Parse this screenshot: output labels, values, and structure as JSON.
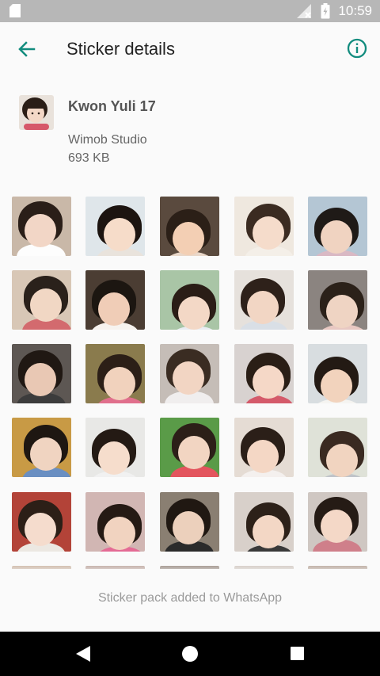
{
  "status_bar": {
    "time": "10:59",
    "icons": [
      "sd-card-icon",
      "signal-icon",
      "battery-icon"
    ]
  },
  "app_bar": {
    "title": "Sticker details",
    "back_icon": "arrow-left-icon",
    "info_icon": "info-icon",
    "accent_color": "#128c7e"
  },
  "pack": {
    "name": "Kwon Yuli 17",
    "publisher": "Wimob Studio",
    "size": "693 KB"
  },
  "stickers": [
    {
      "bg": "#c9b8a8",
      "hair": "#2a1e18",
      "skin": "#f2d6c6",
      "cloth": "#fdfdfd"
    },
    {
      "bg": "#dfe6ea",
      "hair": "#1c1410",
      "skin": "#f6dcc9",
      "cloth": "#e9e3dc"
    },
    {
      "bg": "#5a4a3e",
      "hair": "#2b1f17",
      "skin": "#f3cfb4",
      "cloth": "#e9d7c9"
    },
    {
      "bg": "#efe8df",
      "hair": "#3b2b21",
      "skin": "#f5dccb",
      "cloth": "#f4efe8"
    },
    {
      "bg": "#b4c6d4",
      "hair": "#1f1a17",
      "skin": "#f0d3c1",
      "cloth": "#d9b9c4"
    },
    {
      "bg": "#d8c7b6",
      "hair": "#2a211b",
      "skin": "#f1d7c4",
      "cloth": "#d36a6e"
    },
    {
      "bg": "#4b3d33",
      "hair": "#1c1611",
      "skin": "#f0cdb7",
      "cloth": "#f7f3ef"
    },
    {
      "bg": "#a9c5a6",
      "hair": "#2a1d16",
      "skin": "#f3d8c6",
      "cloth": "#e9edf2"
    },
    {
      "bg": "#e6e1dc",
      "hair": "#2e211a",
      "skin": "#f2d6c4",
      "cloth": "#d9dfe6"
    },
    {
      "bg": "#8b8480",
      "hair": "#2b2119",
      "skin": "#efd4c3",
      "cloth": "#e8c8c2"
    },
    {
      "bg": "#5d5753",
      "hair": "#201813",
      "skin": "#e9c8b4",
      "cloth": "#3c3c3c"
    },
    {
      "bg": "#8a7b4d",
      "hair": "#2c1f17",
      "skin": "#f1d2bd",
      "cloth": "#e06f8c"
    },
    {
      "bg": "#c5bdb7",
      "hair": "#3a2c22",
      "skin": "#f2d5c3",
      "cloth": "#f0eeee"
    },
    {
      "bg": "#d8d2d0",
      "hair": "#2a1e16",
      "skin": "#f5d8c7",
      "cloth": "#d45a6a"
    },
    {
      "bg": "#d8dde0",
      "hair": "#231a14",
      "skin": "#f2d3bd",
      "cloth": "#f5f4f1"
    },
    {
      "bg": "#c89a45",
      "hair": "#1e1712",
      "skin": "#f0d4c1",
      "cloth": "#6a8fc2"
    },
    {
      "bg": "#e8e8e6",
      "hair": "#241a14",
      "skin": "#f6ddcc",
      "cloth": "#f1f1f1"
    },
    {
      "bg": "#5a9b48",
      "hair": "#2c1f18",
      "skin": "#f2d5c2",
      "cloth": "#e3555e"
    },
    {
      "bg": "#e5dcd4",
      "hair": "#2b1f18",
      "skin": "#f4d7c5",
      "cloth": "#f4f0ee"
    },
    {
      "bg": "#dfe2d8",
      "hair": "#3a2a21",
      "skin": "#f1d4c0",
      "cloth": "#c0c4c9"
    },
    {
      "bg": "#b34338",
      "hair": "#2c1f17",
      "skin": "#f5dccd",
      "cloth": "#ece8e2"
    },
    {
      "bg": "#d1b6b3",
      "hair": "#251a14",
      "skin": "#f1d3c0",
      "cloth": "#e46b95"
    },
    {
      "bg": "#8a7f72",
      "hair": "#201812",
      "skin": "#ecd0bc",
      "cloth": "#2b2b2b"
    },
    {
      "bg": "#d8d0ca",
      "hair": "#2d2119",
      "skin": "#f3d7c5",
      "cloth": "#393939"
    },
    {
      "bg": "#cfc7c2",
      "hair": "#251b15",
      "skin": "#f4d8c7",
      "cloth": "#cf7f8a"
    },
    {
      "bg": "#cdb7a6",
      "hair": "#2b2019",
      "skin": "#f0d3c1",
      "cloth": "#ece7e1"
    },
    {
      "bg": "#bfa9a1",
      "hair": "#271d16",
      "skin": "#f1d4c2",
      "cloth": "#ddd1c8"
    },
    {
      "bg": "#9c8f86",
      "hair": "#2a1f18",
      "skin": "#efd1be",
      "cloth": "#e4dcd6"
    },
    {
      "bg": "#d3cac3",
      "hair": "#2c2119",
      "skin": "#f3d6c4",
      "cloth": "#e2d6d0"
    },
    {
      "bg": "#b9a89c",
      "hair": "#241a14",
      "skin": "#f2d5c3",
      "cloth": "#dfd7d0"
    }
  ],
  "footer": {
    "message": "Sticker pack added to WhatsApp"
  },
  "nav_bar": {
    "icons": [
      "nav-back-icon",
      "nav-home-icon",
      "nav-recents-icon"
    ]
  }
}
